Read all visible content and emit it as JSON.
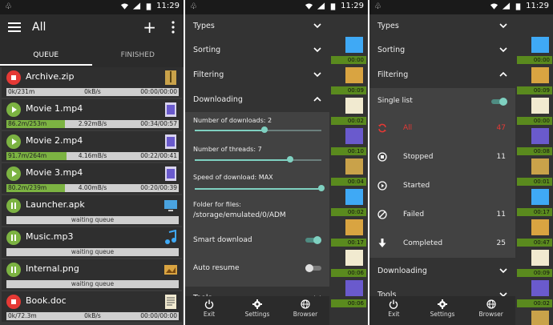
{
  "status": {
    "time": "11:29"
  },
  "colors": {
    "accent": "#7fd1c1",
    "progress": "#7cb342",
    "stop": "#e53935",
    "active_filter": "#e53935"
  },
  "phone1": {
    "title": "All",
    "tabs": [
      "QUEUE",
      "FINISHED"
    ],
    "items": [
      {
        "name": "Archive.zip",
        "state": "stopped",
        "icon": "archive-icon",
        "left": "0k/231m",
        "center": "0kB/s",
        "right": "00:00/00:00",
        "progress": 0
      },
      {
        "name": "Movie 1.mp4",
        "state": "downloading",
        "icon": "video-file-icon",
        "left": "86.2m/253m",
        "center": "2.92mB/s",
        "right": "00:34/00:57",
        "progress": 0.34
      },
      {
        "name": "Movie 2.mp4",
        "state": "downloading",
        "icon": "video-file-icon",
        "left": "91.7m/264m",
        "center": "4.16mB/s",
        "right": "00:22/00:41",
        "progress": 0.35
      },
      {
        "name": "Movie 3.mp4",
        "state": "downloading",
        "icon": "video-file-icon",
        "left": "80.2m/239m",
        "center": "4.00mB/s",
        "right": "00:20/00:39",
        "progress": 0.34
      },
      {
        "name": "Launcher.apk",
        "state": "paused",
        "icon": "monitor-icon",
        "waiting": "waiting queue"
      },
      {
        "name": "Music.mp3",
        "state": "paused",
        "icon": "music-note-icon",
        "waiting": "waiting queue"
      },
      {
        "name": "Internal.png",
        "state": "paused",
        "icon": "image-file-icon",
        "waiting": "waiting queue"
      },
      {
        "name": "Book.doc",
        "state": "stopped",
        "icon": "document-icon",
        "left": "0k/72.3m",
        "center": "0kB/s",
        "right": "00:00/00:00",
        "progress": 0
      }
    ]
  },
  "phone2": {
    "sections": {
      "types": "Types",
      "sorting": "Sorting",
      "filtering": "Filtering",
      "downloading": "Downloading",
      "tools": "Tools"
    },
    "settings": {
      "num_downloads": "Number of downloads: 2",
      "num_downloads_value": 0.55,
      "num_threads": "Number of threads: 7",
      "num_threads_value": 0.75,
      "speed": "Speed of download: MAX",
      "speed_value": 1.0,
      "folder_label": "Folder for files:",
      "folder_path": "/storage/emulated/0/ADM",
      "smart_download": "Smart download",
      "smart_download_on": true,
      "auto_resume": "Auto resume",
      "auto_resume_on": false
    },
    "strip_times": [
      "00:00",
      "00:09",
      "00:02",
      "00:10",
      "00:04",
      "00:02",
      "00:17",
      "00:06",
      "00:06"
    ]
  },
  "phone3": {
    "sections": {
      "types": "Types",
      "sorting": "Sorting",
      "filtering": "Filtering",
      "downloading": "Downloading",
      "tools": "Tools"
    },
    "single_list": "Single list",
    "single_list_on": true,
    "filters": [
      {
        "label": "All",
        "count": "47",
        "icon": "refresh-icon",
        "active": true
      },
      {
        "label": "Stopped",
        "count": "11",
        "icon": "stop-circle-icon",
        "active": false
      },
      {
        "label": "Started",
        "count": "",
        "icon": "play-circle-icon",
        "active": false
      },
      {
        "label": "Failed",
        "count": "11",
        "icon": "block-icon",
        "active": false
      },
      {
        "label": "Completed",
        "count": "25",
        "icon": "download-arrow-icon",
        "active": false
      }
    ],
    "strip_times": [
      "00:00",
      "00:09",
      "00:00",
      "00:08",
      "00:01",
      "00:17",
      "00:47",
      "00:09",
      "00:02",
      "00:51"
    ]
  },
  "bottom_nav": [
    "Exit",
    "Settings",
    "Browser"
  ]
}
